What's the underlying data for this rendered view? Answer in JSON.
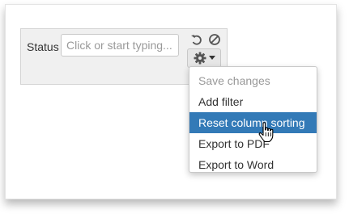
{
  "filter": {
    "status_label": "Status",
    "status_placeholder": "Click or start typing..."
  },
  "toolbar": {
    "undo_icon": "undo-icon",
    "clear_icon": "clear-icon",
    "gear_icon": "gear-icon"
  },
  "menu": {
    "items": [
      {
        "label": "Save changes",
        "state": "disabled"
      },
      {
        "label": "Add filter",
        "state": "normal"
      },
      {
        "label": "Reset column sorting",
        "state": "highlighted"
      },
      {
        "label": "Export to PDF",
        "state": "normal"
      },
      {
        "label": "Export to Word",
        "state": "normal"
      }
    ]
  },
  "colors": {
    "highlight": "#337ab7",
    "disabled_text": "#999999",
    "text": "#333333"
  }
}
